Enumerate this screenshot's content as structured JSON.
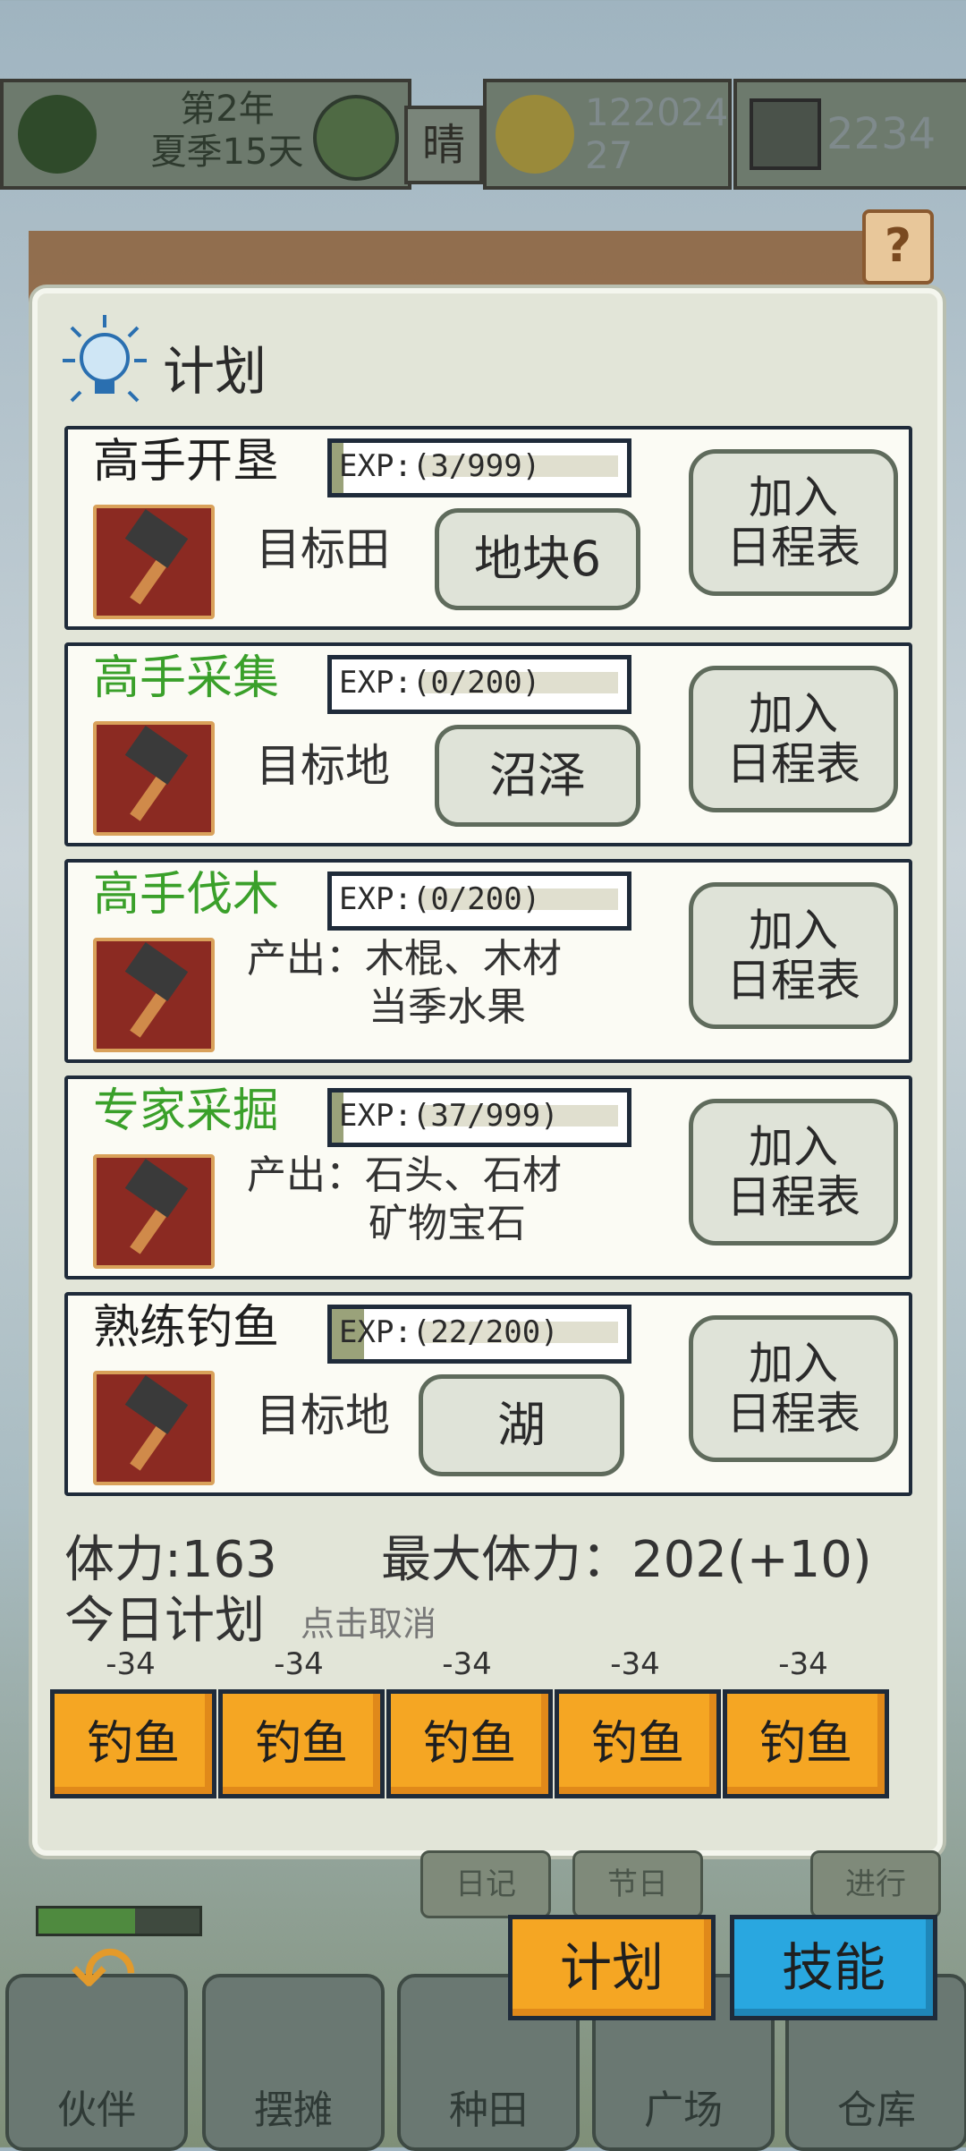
{
  "topbar": {
    "date_line1": "第2年",
    "date_line2": "夏季15天",
    "weather": "晴",
    "coins_line1": "122024",
    "coins_line2": "27",
    "gems": "2234",
    "help": "?"
  },
  "panel": {
    "title": "计划",
    "bulb_icon": "lightbulb-icon"
  },
  "skills": [
    {
      "name": "高手开垦",
      "name_color": "#1f1f1f",
      "exp": "EXP:(3/999)",
      "progress": 0.003,
      "mode": "target",
      "target_label": "目标田",
      "target_value": "地块6",
      "add_label_1": "加入",
      "add_label_2": "日程表",
      "icon": "hammer-icon"
    },
    {
      "name": "高手采集",
      "name_color": "#3aa02a",
      "exp": "EXP:(0/200)",
      "progress": 0,
      "mode": "target",
      "target_label": "目标地",
      "target_value": "沼泽",
      "add_label_1": "加入",
      "add_label_2": "日程表",
      "icon": "basket-icon"
    },
    {
      "name": "高手伐木",
      "name_color": "#3aa02a",
      "exp": "EXP:(0/200)",
      "progress": 0,
      "mode": "output",
      "output_1": "产出：木棍、木材",
      "output_2": "当季水果",
      "add_label_1": "加入",
      "add_label_2": "日程表",
      "icon": "axe-icon"
    },
    {
      "name": "专家采掘",
      "name_color": "#3aa02a",
      "exp": "EXP:(37/999)",
      "progress": 0.037,
      "mode": "output",
      "output_1": "产出：石头、石材",
      "output_2": "矿物宝石",
      "add_label_1": "加入",
      "add_label_2": "日程表",
      "icon": "pickaxe-icon"
    },
    {
      "name": "熟练钓鱼",
      "name_color": "#1f1f1f",
      "exp": "EXP:(22/200)",
      "progress": 0.11,
      "mode": "target",
      "target_label": "目标地",
      "target_value": "湖",
      "add_label_1": "加入",
      "add_label_2": "日程表",
      "icon": "fishing-rod-icon"
    }
  ],
  "stamina": "体力:163",
  "max_stamina": "最大体力：202(+10)",
  "today_plan": "今日计划",
  "cancel_hint": "点击取消",
  "plan_slots": [
    {
      "cost": "-34",
      "label": "钓鱼"
    },
    {
      "cost": "-34",
      "label": "钓鱼"
    },
    {
      "cost": "-34",
      "label": "钓鱼"
    },
    {
      "cost": "-34",
      "label": "钓鱼"
    },
    {
      "cost": "-34",
      "label": "钓鱼"
    }
  ],
  "sub_tabs": [
    "日记",
    "节日",
    "进行"
  ],
  "bottom": {
    "plan": "计划",
    "skill": "技能",
    "nav": [
      "伙伴",
      "摆摊",
      "种田",
      "广场",
      "仓库"
    ],
    "stamina_bar": 0.6
  }
}
